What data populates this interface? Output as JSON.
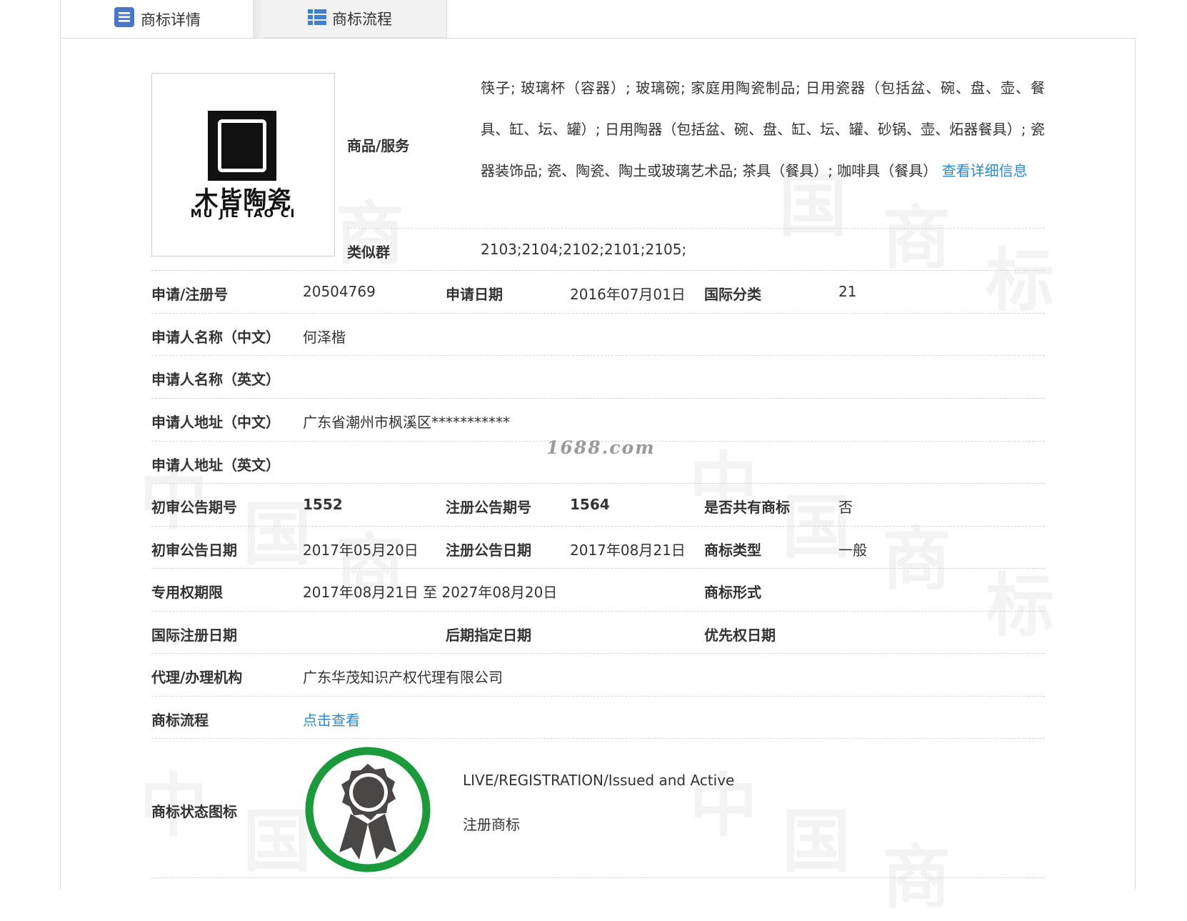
{
  "tabs": [
    {
      "label": "商标详情",
      "icon": "document-list-icon",
      "active": true
    },
    {
      "label": "商标流程",
      "icon": "list-icon",
      "active": false
    }
  ],
  "logo": {
    "cn": "木皆陶瓷",
    "en": "MU JIE TAO CI"
  },
  "goods": {
    "label": "商品/服务",
    "text": "筷子; 玻璃杯（容器）; 玻璃碗; 家庭用陶瓷制品; 日用瓷器（包括盆、碗、盘、壶、餐具、缸、坛、罐）; 日用陶器（包括盆、碗、盘、缸、坛、罐、砂锅、壶、炻器餐具）; 瓷器装饰品; 瓷、陶瓷、陶土或玻璃艺术品; 茶具（餐具）; 咖啡具（餐具）",
    "more_link": "查看详细信息"
  },
  "similar_group": {
    "label": "类似群",
    "value": "2103;2104;2102;2101;2105;"
  },
  "reg": {
    "no_label": "申请/注册号",
    "no_value": "20504769",
    "date_label": "申请日期",
    "date_value": "2016年07月01日",
    "class_label": "国际分类",
    "class_value": "21"
  },
  "applicant_cn": {
    "label": "申请人名称（中文）",
    "value": "何泽楷"
  },
  "applicant_en": {
    "label": "申请人名称（英文）",
    "value": ""
  },
  "address_cn": {
    "label": "申请人地址（中文）",
    "value": "广东省潮州市枫溪区***********"
  },
  "address_en": {
    "label": "申请人地址（英文）",
    "value": ""
  },
  "notice_no": {
    "prelim_label": "初审公告期号",
    "prelim_value": "1552",
    "reg_label": "注册公告期号",
    "reg_value": "1564",
    "shared_label": "是否共有商标",
    "shared_value": "否"
  },
  "notice_date": {
    "prelim_label": "初审公告日期",
    "prelim_value": "2017年05月20日",
    "reg_label": "注册公告日期",
    "reg_value": "2017年08月21日",
    "type_label": "商标类型",
    "type_value": "一般"
  },
  "exclusive": {
    "label": "专用权期限",
    "value": "2017年08月21日 至 2027年08月20日",
    "form_label": "商标形式",
    "form_value": ""
  },
  "intl": {
    "reg_date_label": "国际注册日期",
    "reg_date_value": "",
    "later_label": "后期指定日期",
    "later_value": "",
    "priority_label": "优先权日期",
    "priority_value": ""
  },
  "agency": {
    "label": "代理/办理机构",
    "value": "广东华茂知识产权代理有限公司"
  },
  "process": {
    "label": "商标流程",
    "link": "点击查看"
  },
  "status": {
    "label": "商标状态图标",
    "en": "LIVE/REGISTRATION/Issued and Active",
    "cn": "注册商标",
    "icon": "award-badge-icon",
    "ring_color": "#1a9a3a",
    "badge_color": "#4a4646"
  },
  "watermark_site": "1688.com",
  "colors": {
    "link": "#2a8bd0",
    "text": "#333333",
    "border": "#dcdcdc"
  }
}
